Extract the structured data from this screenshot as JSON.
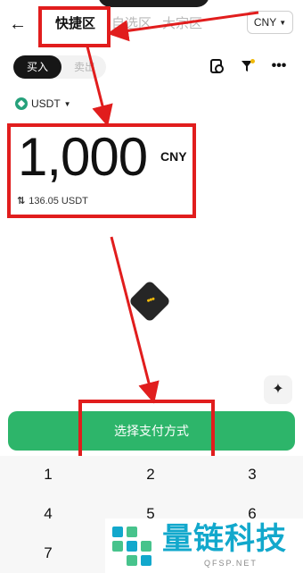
{
  "header": {
    "back_icon": "arrow-left-icon",
    "tabs": [
      {
        "label": "快捷区",
        "active": true
      },
      {
        "label": "自选区",
        "active": false
      },
      {
        "label": "大宗区",
        "active": false
      }
    ],
    "currency_select": "CNY"
  },
  "trade_mode": {
    "buy_label": "买入",
    "sell_label": "卖出",
    "selected": "买入"
  },
  "toolbar_icons": [
    "orders-icon",
    "filter-icon",
    "more-icon"
  ],
  "token_select": {
    "label": "USDT",
    "icon": "usdt-icon"
  },
  "amount": {
    "value": "1,000",
    "currency": "CNY",
    "conversion": "136.05 USDT"
  },
  "pay_button": {
    "label": "选择支付方式"
  },
  "keypad": {
    "keys": [
      "1",
      "2",
      "3",
      "4",
      "5",
      "6",
      "7"
    ]
  },
  "watermark": {
    "title": "量链科技",
    "subtitle": "QFSP.NET"
  },
  "colors": {
    "accent_green": "#2db56a",
    "annotation_red": "#e11d1d",
    "watermark_blue": "#12a8cc",
    "brand_yellow": "#f0b90b"
  }
}
